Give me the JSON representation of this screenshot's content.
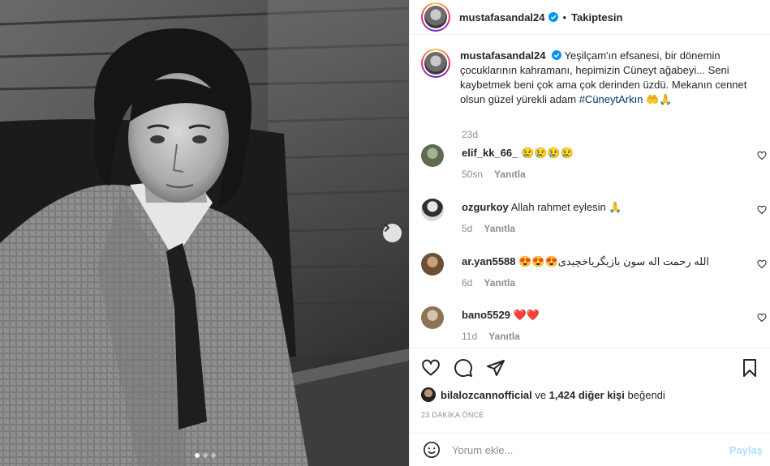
{
  "post": {
    "username": "mustafasandal24",
    "dot": "•",
    "follow_state": "Takiptesin",
    "caption_text": "Yeşilçam'ın efsanesi, bir dönemin çocuklarının kahramanı, hepimizin Cüneyt ağabeyi... Seni kaybetmek beni çok ama çok derinden üzdü. Mekanın cennet olsun güzel yürekli adam",
    "caption_hashtag": "#CüneytArkın",
    "caption_emoji": "🤲🙏",
    "caption_time": "23d"
  },
  "comments": [
    {
      "username": "elif_kk_66_",
      "text": "😢😢😢😢",
      "time": "50sn",
      "reply": "Yanıtla",
      "avatar_color": "#7a8a6a"
    },
    {
      "username": "ozgurkoy",
      "text": "Allah rahmet eylesin 🙏",
      "time": "5d",
      "reply": "Yanıtla",
      "avatar_color": "#3c3c3c"
    },
    {
      "username": "ar.yan5588",
      "text": "😍😍😍الله رحمت اله سون بازیگریاخچیدی",
      "time": "6d",
      "reply": "Yanıtla",
      "avatar_color": "#8a6a4e"
    },
    {
      "username": "bano5529",
      "text": "❤️❤️",
      "time": "11d",
      "reply": "Yanıtla",
      "avatar_color": "#a08a6c"
    }
  ],
  "likes": {
    "first_user": "bilalozcannofficial",
    "connector": "ve",
    "count_text": "1,424 diğer kişi",
    "suffix": "beğendi"
  },
  "timestamp": "23 DAKİKA ÖNCE",
  "composer": {
    "placeholder": "Yorum ekle...",
    "share_label": "Paylaş"
  },
  "carousel": {
    "dots": 3,
    "active_index": 0
  },
  "colors": {
    "verified": "#0095f6",
    "share_disabled": "#b2dffc",
    "hashtag": "#00376b",
    "heart_red": "#ed4956"
  },
  "icons": [
    "heart-icon",
    "comment-icon",
    "share-icon",
    "bookmark-icon",
    "emoji-icon",
    "chevron-right-icon",
    "verified-icon"
  ]
}
